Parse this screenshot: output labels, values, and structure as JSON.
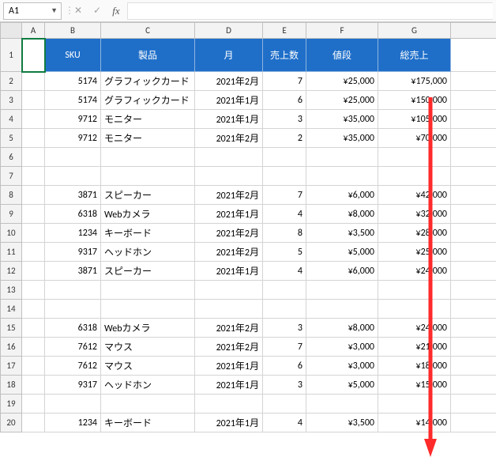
{
  "formula_bar": {
    "cell_ref": "A1",
    "cancel_icon": "✕",
    "confirm_icon": "✓",
    "fx_label": "fx",
    "value": ""
  },
  "columns": [
    "",
    "A",
    "B",
    "C",
    "D",
    "E",
    "F",
    "G"
  ],
  "header": {
    "sku": "SKU",
    "product": "製品",
    "month": "月",
    "units": "売上数",
    "price": "値段",
    "total": "総売上"
  },
  "rows": [
    {
      "n": "1",
      "sku": "",
      "product": "",
      "month": "",
      "units": "",
      "price": "",
      "total": ""
    },
    {
      "n": "2",
      "sku": "5174",
      "product": "グラフィックカード",
      "month": "2021年2月",
      "units": "7",
      "price": "¥25,000",
      "total": "¥175,000"
    },
    {
      "n": "3",
      "sku": "5174",
      "product": "グラフィックカード",
      "month": "2021年1月",
      "units": "6",
      "price": "¥25,000",
      "total": "¥150,000"
    },
    {
      "n": "4",
      "sku": "9712",
      "product": "モニター",
      "month": "2021年1月",
      "units": "3",
      "price": "¥35,000",
      "total": "¥105,000"
    },
    {
      "n": "5",
      "sku": "9712",
      "product": "モニター",
      "month": "2021年2月",
      "units": "2",
      "price": "¥35,000",
      "total": "¥70,000"
    },
    {
      "n": "6",
      "sku": "",
      "product": "",
      "month": "",
      "units": "",
      "price": "",
      "total": ""
    },
    {
      "n": "7",
      "sku": "",
      "product": "",
      "month": "",
      "units": "",
      "price": "",
      "total": ""
    },
    {
      "n": "8",
      "sku": "3871",
      "product": "スピーカー",
      "month": "2021年2月",
      "units": "7",
      "price": "¥6,000",
      "total": "¥42,000"
    },
    {
      "n": "9",
      "sku": "6318",
      "product": "Webカメラ",
      "month": "2021年1月",
      "units": "4",
      "price": "¥8,000",
      "total": "¥32,000"
    },
    {
      "n": "10",
      "sku": "1234",
      "product": "キーボード",
      "month": "2021年2月",
      "units": "8",
      "price": "¥3,500",
      "total": "¥28,000"
    },
    {
      "n": "11",
      "sku": "9317",
      "product": "ヘッドホン",
      "month": "2021年2月",
      "units": "5",
      "price": "¥5,000",
      "total": "¥25,000"
    },
    {
      "n": "12",
      "sku": "3871",
      "product": "スピーカー",
      "month": "2021年1月",
      "units": "4",
      "price": "¥6,000",
      "total": "¥24,000"
    },
    {
      "n": "13",
      "sku": "",
      "product": "",
      "month": "",
      "units": "",
      "price": "",
      "total": ""
    },
    {
      "n": "14",
      "sku": "",
      "product": "",
      "month": "",
      "units": "",
      "price": "",
      "total": ""
    },
    {
      "n": "15",
      "sku": "6318",
      "product": "Webカメラ",
      "month": "2021年2月",
      "units": "3",
      "price": "¥8,000",
      "total": "¥24,000"
    },
    {
      "n": "16",
      "sku": "7612",
      "product": "マウス",
      "month": "2021年2月",
      "units": "7",
      "price": "¥3,000",
      "total": "¥21,000"
    },
    {
      "n": "17",
      "sku": "7612",
      "product": "マウス",
      "month": "2021年1月",
      "units": "6",
      "price": "¥3,000",
      "total": "¥18,000"
    },
    {
      "n": "18",
      "sku": "9317",
      "product": "ヘッドホン",
      "month": "2021年1月",
      "units": "3",
      "price": "¥5,000",
      "total": "¥15,000"
    },
    {
      "n": "19",
      "sku": "",
      "product": "",
      "month": "",
      "units": "",
      "price": "",
      "total": ""
    },
    {
      "n": "20",
      "sku": "1234",
      "product": "キーボード",
      "month": "2021年1月",
      "units": "4",
      "price": "¥3,500",
      "total": "¥14,000"
    }
  ],
  "arrow_color": "#ff2a2a"
}
